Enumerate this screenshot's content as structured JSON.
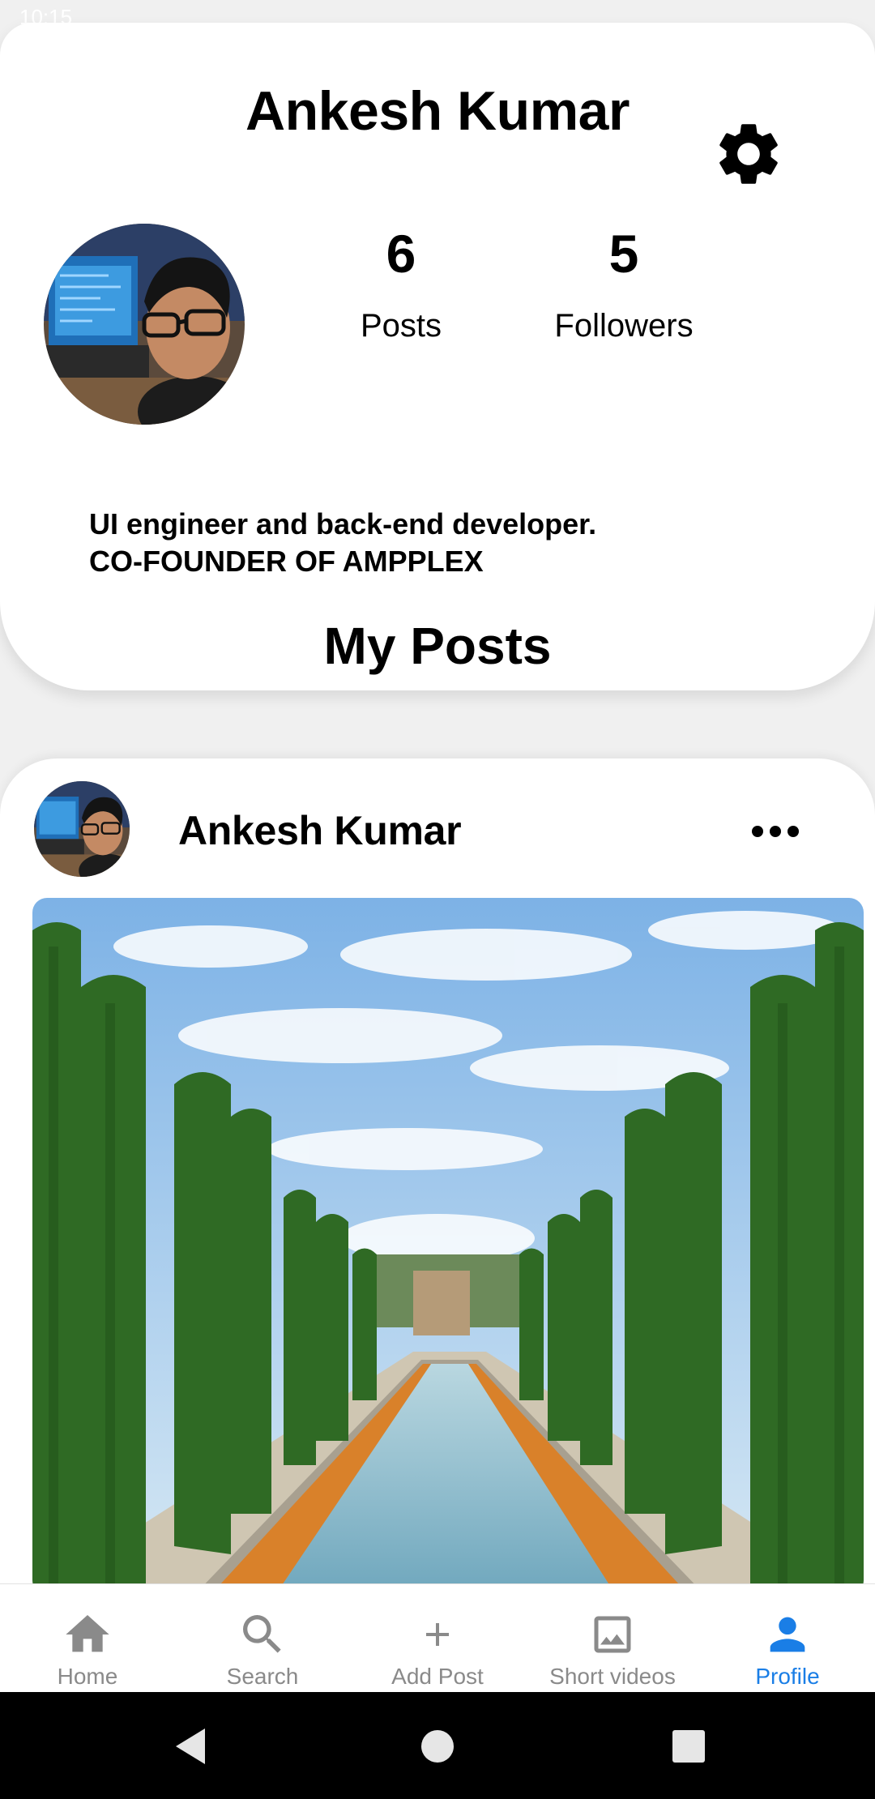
{
  "status_bar": {
    "time": "10:15"
  },
  "profile": {
    "name": "Ankesh Kumar",
    "stats": {
      "posts_count": "6",
      "posts_label": "Posts",
      "followers_count": "5",
      "followers_label": "Followers"
    },
    "bio_line1": "UI engineer and back-end developer.",
    "bio_line2": "CO-FOUNDER OF AMPPLEX"
  },
  "section_title": "My Posts",
  "post": {
    "author": "Ankesh Kumar"
  },
  "bottom_nav": {
    "items": [
      {
        "label": "Home",
        "icon": "home-icon"
      },
      {
        "label": "Search",
        "icon": "search-icon"
      },
      {
        "label": "Add Post",
        "icon": "plus-icon"
      },
      {
        "label": "Short videos",
        "icon": "image-icon"
      },
      {
        "label": "Profile",
        "icon": "person-icon"
      }
    ],
    "active_index": 4
  },
  "colors": {
    "accent": "#1a7ee6",
    "inactive": "#8a8a8a",
    "card_bg": "#ffffff",
    "page_bg": "#f0f0f0"
  }
}
